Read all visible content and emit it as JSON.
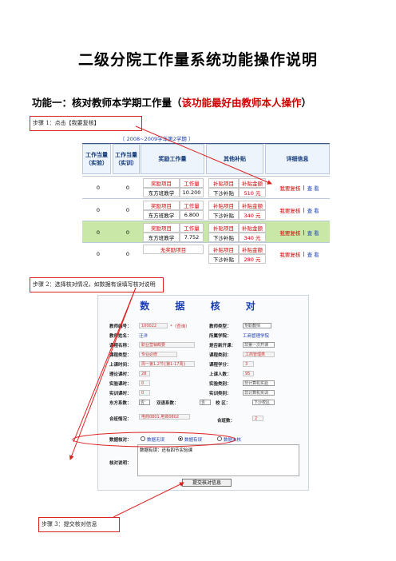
{
  "doc_title": "二级分院工作量系统功能操作说明",
  "function1": {
    "prefix": "功能一：核对教师本学期工作量（",
    "highlight": "该功能最好由教师本人操作",
    "suffix": "）"
  },
  "step1": "步骤 1：点击【我要复核】",
  "step2": "步骤 2：选择核对情况，如数据有误填写核对说明",
  "step3": "步骤 3：提交核对信息",
  "shot1": {
    "semester": "〔 2008~2009学年第2学期 〕",
    "headers": [
      "工作当量\n（实验）",
      "工作当量\n（实训）",
      "奖励工作量",
      "其他补贴",
      "详细信息"
    ],
    "rows": [
      {
        "a": "0",
        "b": "0",
        "award": [
          [
            "奖励项目",
            "工作量"
          ],
          [
            "东方班教学",
            "10.200"
          ]
        ],
        "sub": [
          [
            "补贴项目",
            "补贴金额"
          ],
          [
            "下沙补贴",
            "510 元"
          ]
        ],
        "actions": [
          "我要复核",
          "|",
          "查 看"
        ]
      },
      {
        "a": "0",
        "b": "0",
        "award": [
          [
            "奖励项目",
            "工作量"
          ],
          [
            "东方班教学",
            "6.800"
          ]
        ],
        "sub": [
          [
            "补贴项目",
            "补贴金额"
          ],
          [
            "下沙补贴",
            "340 元"
          ]
        ],
        "actions": [
          "我要复核",
          "|",
          "查 看"
        ]
      },
      {
        "a": "0",
        "b": "0",
        "award": [
          [
            "奖励项目",
            "工作量"
          ],
          [
            "东方班教学",
            "7.752"
          ]
        ],
        "sub": [
          [
            "补贴项目",
            "补贴金额"
          ],
          [
            "下沙补贴",
            "340 元"
          ]
        ],
        "actions": [
          "我要复核",
          "|",
          "查 看"
        ]
      },
      {
        "a": "0",
        "b": "0",
        "award": [
          [
            "无奖励项目",
            ""
          ]
        ],
        "sub": [
          [
            "补贴项目",
            "补贴金额"
          ],
          [
            "下沙补贴",
            "280 元"
          ]
        ],
        "actions": [
          "我要复核",
          "|",
          "查 看"
        ]
      }
    ]
  },
  "shot2": {
    "title": "数 据 核 对",
    "fields": {
      "teacher_no_label": "教师编号：",
      "teacher_no": "100022",
      "teacher_no_note": "*（查询）",
      "teacher_type_label": "教师类型：",
      "teacher_type": "专职教师",
      "teacher_name_label": "教师姓名：",
      "teacher_name": "汪洋",
      "college_label": "所属学院：",
      "college": "工商管理学院",
      "course_name_label": "课程名称：",
      "course_name": "职业营销概要",
      "first_open_label": "是否新开课：",
      "first_open": "非第一次开课",
      "course_type_label": "课程类型：",
      "course_type": "专业必修",
      "course_cat_label": "课程类别：",
      "course_cat": "工商管理类",
      "class_time_label": "上课时间：",
      "class_time": "周一第1,2节{第1-17周}",
      "credit_label": "课程学分：",
      "credit": "3",
      "theory_label": "理论课时：",
      "theory": "28",
      "students_label": "上课人数：",
      "students": "95",
      "exp_hours_label": "实验课时：",
      "exp_hours": "0",
      "exp_cat_label": "实验类别：",
      "exp_cat": "非计算机实验",
      "train_hours_label": "实训课时：",
      "train_hours": "0",
      "train_cat_label": "实训类别：",
      "train_cat": "非计算机实训",
      "east_label": "东方系数：",
      "east": "否",
      "bilingual_label": "双语系数：",
      "bilingual": "否",
      "campus_label": "校 区：",
      "campus": "下沙校区",
      "merge_label": "合班情况：",
      "merge": "电商0801,电商0802",
      "merge_count_label": "合班数：",
      "merge_count": "2",
      "check_label": "数据核对：",
      "opt1": "数据无误",
      "opt2": "数据有误",
      "opt3": "数据未核",
      "note_label": "核对说明：",
      "note_value": "数据有误：还有四节实验课",
      "submit": "提交核对信息"
    }
  },
  "colors": {
    "accent_red": "#d00000",
    "blue": "#1a3fb0",
    "green_row": "#c9e8a8"
  }
}
